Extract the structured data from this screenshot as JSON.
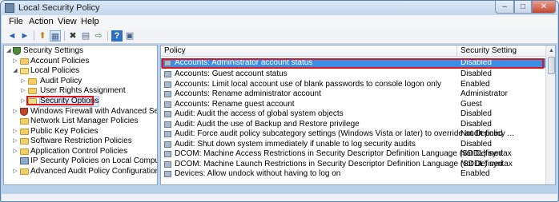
{
  "window": {
    "title": "Local Security Policy",
    "minimize_glyph": "–",
    "maximize_glyph": "□",
    "close_glyph": "✕"
  },
  "menu": {
    "file": "File",
    "action": "Action",
    "view": "View",
    "help": "Help"
  },
  "toolbar": {
    "back_glyph": "◄",
    "forward_glyph": "►",
    "up_glyph": "⬆",
    "console_tree_glyph": "▦",
    "delete_glyph": "✖",
    "properties_glyph": "▤",
    "export_glyph": "⇨",
    "help_glyph": "?",
    "mmc_glyph": "▣"
  },
  "tree": {
    "root": "Security Settings",
    "items": [
      {
        "label": "Account Policies"
      },
      {
        "label": "Local Policies"
      },
      {
        "label": "Audit Policy"
      },
      {
        "label": "User Rights Assignment"
      },
      {
        "label": "Security Options"
      },
      {
        "label": "Windows Firewall with Advanced Security"
      },
      {
        "label": "Network List Manager Policies"
      },
      {
        "label": "Public Key Policies"
      },
      {
        "label": "Software Restriction Policies"
      },
      {
        "label": "Application Control Policies"
      },
      {
        "label": "IP Security Policies on Local Computer"
      },
      {
        "label": "Advanced Audit Policy Configuration"
      }
    ]
  },
  "list": {
    "col_policy": "Policy",
    "col_setting": "Security Setting",
    "rows": [
      {
        "policy": "Accounts: Administrator account status",
        "setting": "Disabled"
      },
      {
        "policy": "Accounts: Guest account status",
        "setting": "Disabled"
      },
      {
        "policy": "Accounts: Limit local account use of blank passwords to console logon only",
        "setting": "Enabled"
      },
      {
        "policy": "Accounts: Rename administrator account",
        "setting": "Administrator"
      },
      {
        "policy": "Accounts: Rename guest account",
        "setting": "Guest"
      },
      {
        "policy": "Audit: Audit the access of global system objects",
        "setting": "Disabled"
      },
      {
        "policy": "Audit: Audit the use of Backup and Restore privilege",
        "setting": "Disabled"
      },
      {
        "policy": "Audit: Force audit policy subcategory settings (Windows Vista or later) to override audit policy ...",
        "setting": "Not Defined"
      },
      {
        "policy": "Audit: Shut down system immediately if unable to log security audits",
        "setting": "Disabled"
      },
      {
        "policy": "DCOM: Machine Access Restrictions in Security Descriptor Definition Language (SDDL) syntax",
        "setting": "Not Defined"
      },
      {
        "policy": "DCOM: Machine Launch Restrictions in Security Descriptor Definition Language (SDDL) syntax",
        "setting": "Not Defined"
      },
      {
        "policy": "Devices: Allow undock without having to log on",
        "setting": "Enabled"
      }
    ]
  },
  "scroll": {
    "up_glyph": "▲",
    "thumb_position": 0.0
  }
}
